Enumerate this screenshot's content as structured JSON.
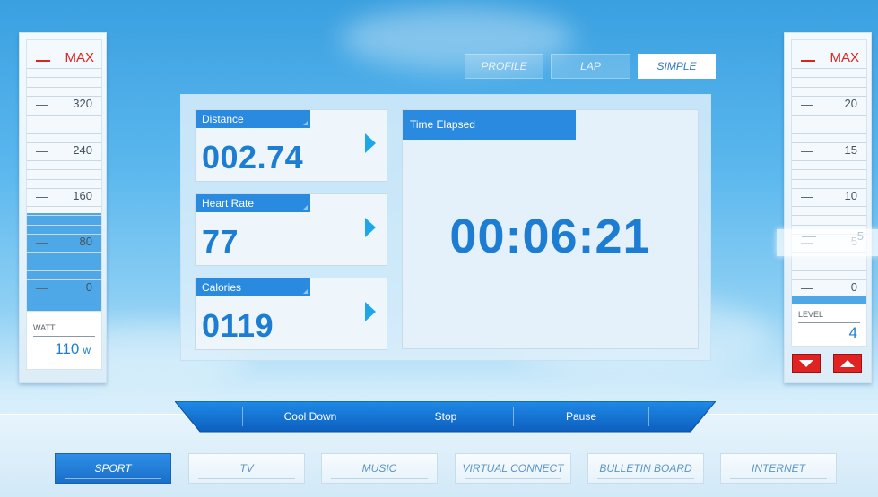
{
  "watt_meter": {
    "max_label": "MAX",
    "ticks": [
      "320",
      "240",
      "160",
      "80",
      "0"
    ],
    "value_label": "WATT",
    "value": "110",
    "unit": "w"
  },
  "level_meter": {
    "max_label": "MAX",
    "ticks": [
      "20",
      "15",
      "10",
      "5",
      "0"
    ],
    "value_label": "LEVEL",
    "value": "4"
  },
  "mode_tabs": [
    {
      "label": "PROFILE",
      "active": false
    },
    {
      "label": "LAP",
      "active": false
    },
    {
      "label": "SIMPLE",
      "active": true
    }
  ],
  "stats": [
    {
      "label": "Distance",
      "value": "002.74"
    },
    {
      "label": "Heart Rate",
      "value": "77"
    },
    {
      "label": "Calories",
      "value": "0119"
    }
  ],
  "time": {
    "label": "Time Elapsed",
    "value": "00:06:21"
  },
  "controls": [
    "Cool Down",
    "Stop",
    "Pause"
  ],
  "nav": [
    {
      "label": "SPORT",
      "active": true
    },
    {
      "label": "TV",
      "active": false
    },
    {
      "label": "MUSIC",
      "active": false
    },
    {
      "label": "VIRTUAL CONNECT",
      "active": false
    },
    {
      "label": "BULLETIN BOARD",
      "active": false
    },
    {
      "label": "INTERNET",
      "active": false
    }
  ],
  "colors": {
    "accent": "#1c7dd2",
    "tag": "#2a8ae0",
    "alert": "#e02222"
  }
}
